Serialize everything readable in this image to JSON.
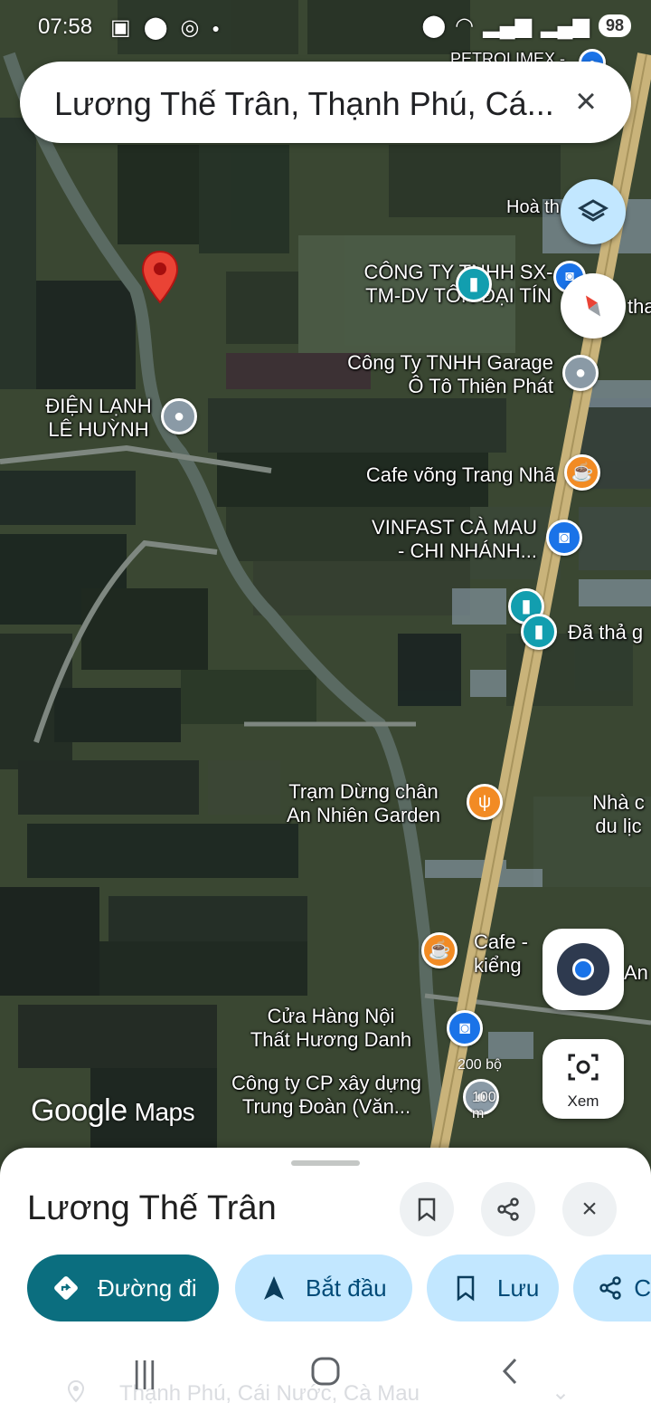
{
  "status_bar": {
    "time": "07:58",
    "battery": "98"
  },
  "search": {
    "query": "Lương Thế Trân, Thạnh Phú, Cá..."
  },
  "map_labels": {
    "petrolimex": "PETROLIMEX -",
    "hoa_th": "Hoà th",
    "tha": "tha",
    "cong_ty_ton_line1": "CÔNG TY TNHH SX-",
    "cong_ty_ton_line2": "TM-DV TÔN ĐẠI TÍN",
    "garage_line1": "Công Ty TNHH Garage",
    "garage_line2": "Ô Tô Thiên Phát",
    "dien_lanh_line1": "ĐIỆN LẠNH",
    "dien_lanh_line2": "LÊ HUỲNH",
    "cafe_vong": "Cafe võng Trang Nhã",
    "vinfast_line1": "VINFAST CÀ MAU",
    "vinfast_line2": "- CHI NHÁNH...",
    "da_tha": "Đã thả g",
    "tram_dung_line1": "Trạm Dừng chân",
    "tram_dung_line2": "An Nhiên Garden",
    "nha_c_line1": "Nhà c",
    "nha_c_line2": "du lịc",
    "cafe_kieng_line1": "Cafe -",
    "cafe_kieng_line2": "kiểng",
    "an": "An",
    "cua_hang_line1": "Cửa Hàng Nội",
    "cua_hang_line2": "Thất Hương Danh",
    "cong_ty_cp_line1": "Công ty CP xây dựng",
    "cong_ty_cp_line2": "Trung Đoàn (Văn..."
  },
  "scale": {
    "feet": "200 bộ",
    "meters": "100 m"
  },
  "branding": {
    "google": "Google",
    "maps": "Maps"
  },
  "lens_button": {
    "label": "Xem"
  },
  "place_sheet": {
    "title": "Lương Thế Trân",
    "actions": [
      {
        "label": "Đường đi"
      },
      {
        "label": "Bắt đầu"
      },
      {
        "label": "Lưu"
      },
      {
        "label": "C"
      }
    ],
    "address_peek": "Thạnh Phú, Cái Nước, Cà Mau"
  },
  "colors": {
    "directions_chip": "#0b6e7f",
    "chip_light": "#c2e7ff",
    "red_pin": "#ea4335",
    "teal_pin": "#129eaf",
    "orange_pin": "#f28b24",
    "blue_pin": "#1a73e8"
  }
}
